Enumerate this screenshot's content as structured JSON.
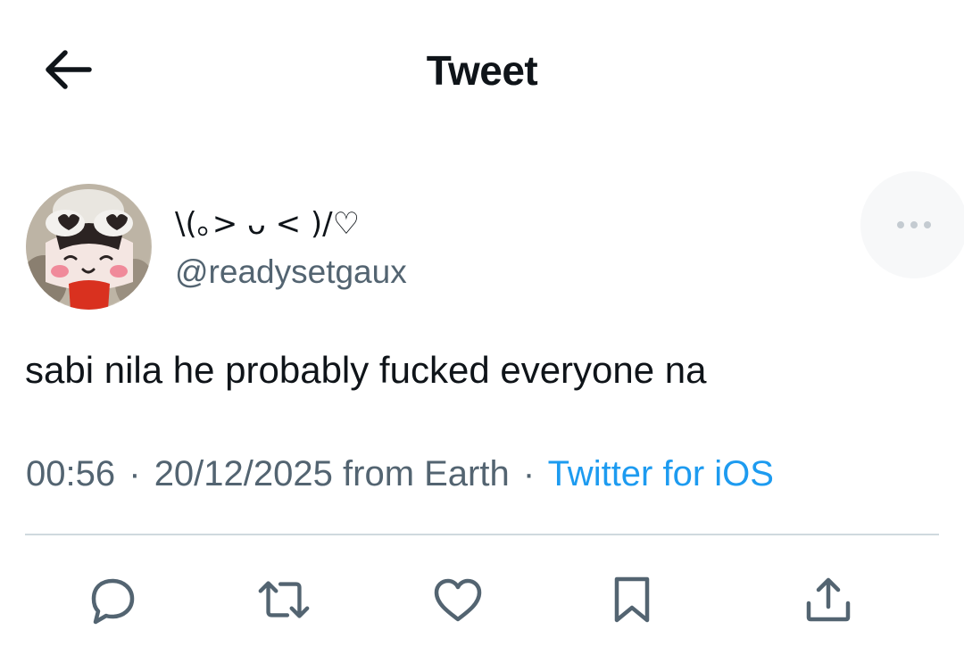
{
  "header": {
    "title": "Tweet",
    "back_icon": "arrow-left-icon"
  },
  "author": {
    "display_name": "\\(｡> ᴗ < )/♡",
    "handle": "@readysetgaux",
    "avatar": "avatar-image"
  },
  "tweet": {
    "text": "sabi nila he probably fucked everyone na",
    "time": "00:56",
    "date": "20/12/2025",
    "location": "from Earth",
    "separator": "·",
    "source": "Twitter for iOS"
  },
  "actions": {
    "icons": [
      "reply-icon",
      "retweet-icon",
      "like-icon",
      "bookmark-icon",
      "share-icon"
    ]
  },
  "colors": {
    "text": "#0f1419",
    "secondary": "#536471",
    "link": "#1d9bf0",
    "divider": "#cfd9de"
  }
}
